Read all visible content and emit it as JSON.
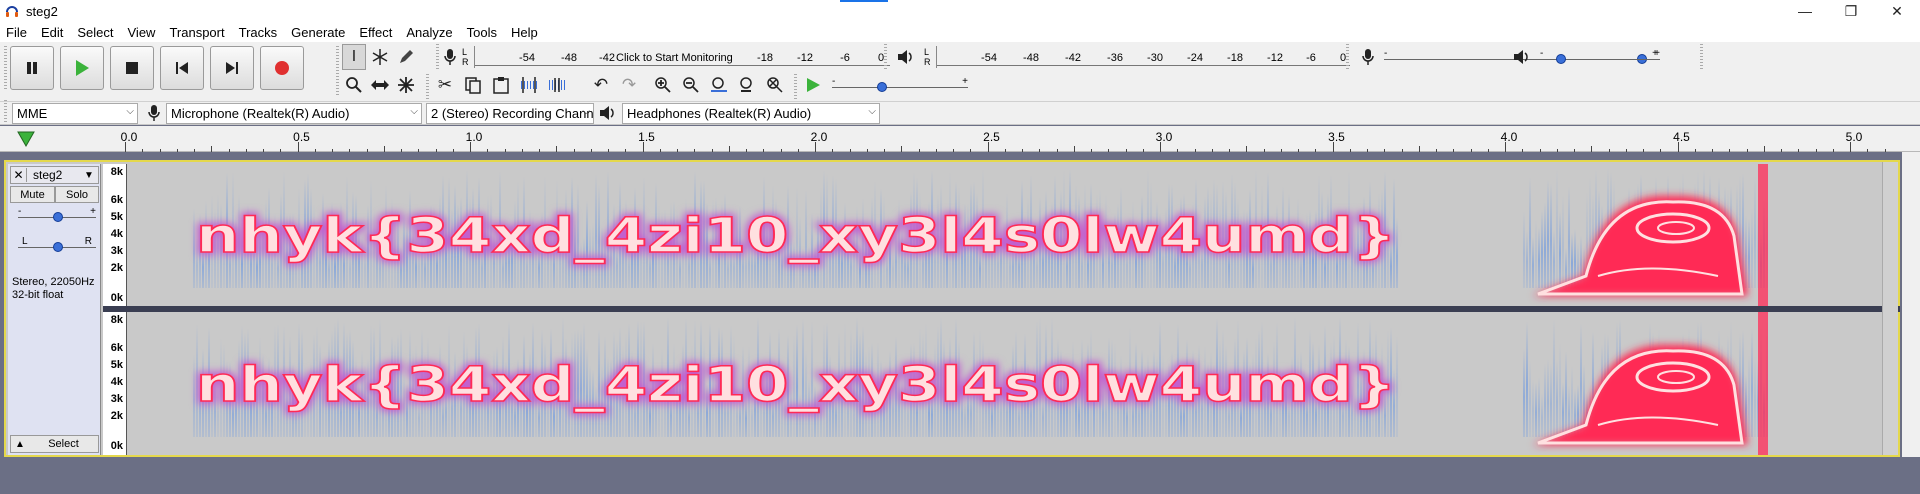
{
  "window": {
    "title": "steg2",
    "controls": {
      "minimize": "—",
      "maximize": "❐",
      "close": "✕"
    }
  },
  "menu": [
    "File",
    "Edit",
    "Select",
    "View",
    "Transport",
    "Tracks",
    "Generate",
    "Effect",
    "Analyze",
    "Tools",
    "Help"
  ],
  "transport": {
    "buttons": [
      "pause",
      "play",
      "stop",
      "skip-to-start",
      "skip-to-end",
      "record"
    ],
    "colors": {
      "play": "#3bb33b",
      "record": "#e03030"
    }
  },
  "tools": [
    "selection-tool",
    "envelope-tool",
    "draw-tool",
    "zoom-tool",
    "timeshift-tool",
    "multi-tool"
  ],
  "edit_tools": [
    "cut",
    "copy",
    "paste",
    "trim",
    "silence"
  ],
  "history_tools": [
    "undo",
    "redo"
  ],
  "zoom_tools": [
    "zoom-in",
    "zoom-out",
    "fit-selection",
    "fit-project",
    "zoom-toggle"
  ],
  "recording_meter": {
    "ticks": [
      "-54",
      "-48",
      "-42",
      "-18",
      "-12",
      "-6",
      "0"
    ],
    "monitor_text": "Click to Start Monitoring"
  },
  "playback_meter": {
    "ticks": [
      "-54",
      "-48",
      "-42",
      "-36",
      "-30",
      "-24",
      "-18",
      "-12",
      "-6",
      "0"
    ]
  },
  "play_at_speed": {
    "minus": "-",
    "plus": "+",
    "level": 0.34
  },
  "mixer": {
    "record_volume": {
      "minus": "-",
      "plus": "+",
      "level": 0.98
    },
    "playback_volume": {
      "minus": "-",
      "plus": "+",
      "level": 0.1
    }
  },
  "devices": {
    "host": "MME",
    "recording_device": "Microphone (Realtek(R) Audio)",
    "channels": "2 (Stereo) Recording Chann",
    "playback_device": "Headphones (Realtek(R) Audio)"
  },
  "timeline": {
    "ticks": [
      "0.0",
      "0.5",
      "1.0",
      "1.5",
      "2.0",
      "2.5",
      "3.0",
      "3.5",
      "4.0",
      "4.5",
      "5.0"
    ]
  },
  "track": {
    "name": "steg2",
    "close": "✕",
    "mute": "Mute",
    "solo": "Solo",
    "gain_minus": "-",
    "gain_plus": "+",
    "pan_left": "L",
    "pan_right": "R",
    "info_line1": "Stereo, 22050Hz",
    "info_line2": "32-bit float",
    "select": "Select",
    "freq_scale": [
      "8k",
      "6k",
      "5k",
      "4k",
      "3k",
      "2k",
      "0k"
    ],
    "hidden_text": "nhyk{34xd_4zi10_xy3l4s0lw4umd}",
    "colors": {
      "background": "#c9c9c9",
      "low": "#4a86e8",
      "mid": "#c060d0",
      "high": "#ff2a55",
      "peak": "#ffe0e0"
    }
  }
}
